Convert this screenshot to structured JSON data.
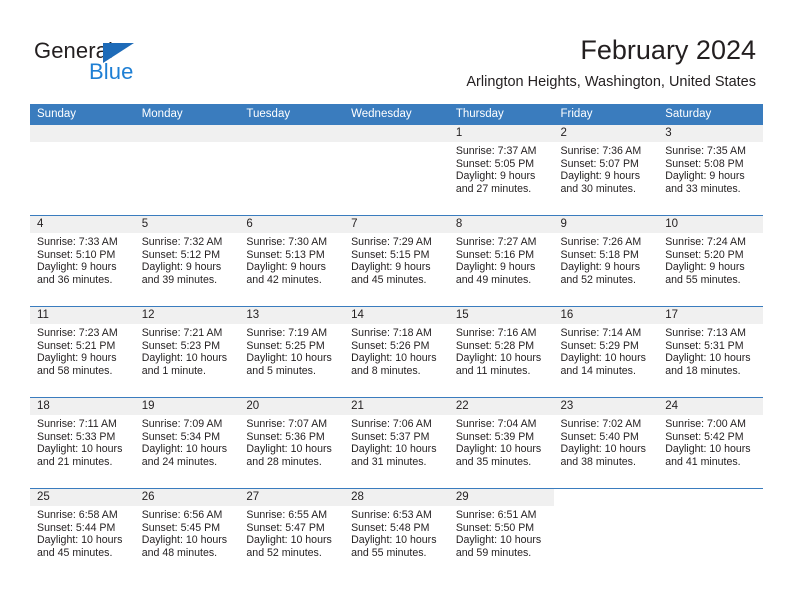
{
  "brand": {
    "name_part1": "General",
    "name_part2": "Blue",
    "logo_icon": "blue-triangle",
    "color_dark": "#231f20",
    "color_blue": "#1e7fd4"
  },
  "header": {
    "title": "February 2024",
    "subtitle": "Arlington Heights, Washington, United States",
    "accent_color": "#3a7cbe"
  },
  "calendar": {
    "weekday_headers": [
      "Sunday",
      "Monday",
      "Tuesday",
      "Wednesday",
      "Thursday",
      "Friday",
      "Saturday"
    ],
    "weeks": [
      [
        {
          "blank": true
        },
        {
          "blank": true
        },
        {
          "blank": true
        },
        {
          "blank": true
        },
        {
          "day": "1",
          "sunrise": "Sunrise: 7:37 AM",
          "sunset": "Sunset: 5:05 PM",
          "daylight_line1": "Daylight: 9 hours",
          "daylight_line2": "and 27 minutes."
        },
        {
          "day": "2",
          "sunrise": "Sunrise: 7:36 AM",
          "sunset": "Sunset: 5:07 PM",
          "daylight_line1": "Daylight: 9 hours",
          "daylight_line2": "and 30 minutes."
        },
        {
          "day": "3",
          "sunrise": "Sunrise: 7:35 AM",
          "sunset": "Sunset: 5:08 PM",
          "daylight_line1": "Daylight: 9 hours",
          "daylight_line2": "and 33 minutes."
        }
      ],
      [
        {
          "day": "4",
          "sunrise": "Sunrise: 7:33 AM",
          "sunset": "Sunset: 5:10 PM",
          "daylight_line1": "Daylight: 9 hours",
          "daylight_line2": "and 36 minutes."
        },
        {
          "day": "5",
          "sunrise": "Sunrise: 7:32 AM",
          "sunset": "Sunset: 5:12 PM",
          "daylight_line1": "Daylight: 9 hours",
          "daylight_line2": "and 39 minutes."
        },
        {
          "day": "6",
          "sunrise": "Sunrise: 7:30 AM",
          "sunset": "Sunset: 5:13 PM",
          "daylight_line1": "Daylight: 9 hours",
          "daylight_line2": "and 42 minutes."
        },
        {
          "day": "7",
          "sunrise": "Sunrise: 7:29 AM",
          "sunset": "Sunset: 5:15 PM",
          "daylight_line1": "Daylight: 9 hours",
          "daylight_line2": "and 45 minutes."
        },
        {
          "day": "8",
          "sunrise": "Sunrise: 7:27 AM",
          "sunset": "Sunset: 5:16 PM",
          "daylight_line1": "Daylight: 9 hours",
          "daylight_line2": "and 49 minutes."
        },
        {
          "day": "9",
          "sunrise": "Sunrise: 7:26 AM",
          "sunset": "Sunset: 5:18 PM",
          "daylight_line1": "Daylight: 9 hours",
          "daylight_line2": "and 52 minutes."
        },
        {
          "day": "10",
          "sunrise": "Sunrise: 7:24 AM",
          "sunset": "Sunset: 5:20 PM",
          "daylight_line1": "Daylight: 9 hours",
          "daylight_line2": "and 55 minutes."
        }
      ],
      [
        {
          "day": "11",
          "sunrise": "Sunrise: 7:23 AM",
          "sunset": "Sunset: 5:21 PM",
          "daylight_line1": "Daylight: 9 hours",
          "daylight_line2": "and 58 minutes."
        },
        {
          "day": "12",
          "sunrise": "Sunrise: 7:21 AM",
          "sunset": "Sunset: 5:23 PM",
          "daylight_line1": "Daylight: 10 hours",
          "daylight_line2": "and 1 minute."
        },
        {
          "day": "13",
          "sunrise": "Sunrise: 7:19 AM",
          "sunset": "Sunset: 5:25 PM",
          "daylight_line1": "Daylight: 10 hours",
          "daylight_line2": "and 5 minutes."
        },
        {
          "day": "14",
          "sunrise": "Sunrise: 7:18 AM",
          "sunset": "Sunset: 5:26 PM",
          "daylight_line1": "Daylight: 10 hours",
          "daylight_line2": "and 8 minutes."
        },
        {
          "day": "15",
          "sunrise": "Sunrise: 7:16 AM",
          "sunset": "Sunset: 5:28 PM",
          "daylight_line1": "Daylight: 10 hours",
          "daylight_line2": "and 11 minutes."
        },
        {
          "day": "16",
          "sunrise": "Sunrise: 7:14 AM",
          "sunset": "Sunset: 5:29 PM",
          "daylight_line1": "Daylight: 10 hours",
          "daylight_line2": "and 14 minutes."
        },
        {
          "day": "17",
          "sunrise": "Sunrise: 7:13 AM",
          "sunset": "Sunset: 5:31 PM",
          "daylight_line1": "Daylight: 10 hours",
          "daylight_line2": "and 18 minutes."
        }
      ],
      [
        {
          "day": "18",
          "sunrise": "Sunrise: 7:11 AM",
          "sunset": "Sunset: 5:33 PM",
          "daylight_line1": "Daylight: 10 hours",
          "daylight_line2": "and 21 minutes."
        },
        {
          "day": "19",
          "sunrise": "Sunrise: 7:09 AM",
          "sunset": "Sunset: 5:34 PM",
          "daylight_line1": "Daylight: 10 hours",
          "daylight_line2": "and 24 minutes."
        },
        {
          "day": "20",
          "sunrise": "Sunrise: 7:07 AM",
          "sunset": "Sunset: 5:36 PM",
          "daylight_line1": "Daylight: 10 hours",
          "daylight_line2": "and 28 minutes."
        },
        {
          "day": "21",
          "sunrise": "Sunrise: 7:06 AM",
          "sunset": "Sunset: 5:37 PM",
          "daylight_line1": "Daylight: 10 hours",
          "daylight_line2": "and 31 minutes."
        },
        {
          "day": "22",
          "sunrise": "Sunrise: 7:04 AM",
          "sunset": "Sunset: 5:39 PM",
          "daylight_line1": "Daylight: 10 hours",
          "daylight_line2": "and 35 minutes."
        },
        {
          "day": "23",
          "sunrise": "Sunrise: 7:02 AM",
          "sunset": "Sunset: 5:40 PM",
          "daylight_line1": "Daylight: 10 hours",
          "daylight_line2": "and 38 minutes."
        },
        {
          "day": "24",
          "sunrise": "Sunrise: 7:00 AM",
          "sunset": "Sunset: 5:42 PM",
          "daylight_line1": "Daylight: 10 hours",
          "daylight_line2": "and 41 minutes."
        }
      ],
      [
        {
          "day": "25",
          "sunrise": "Sunrise: 6:58 AM",
          "sunset": "Sunset: 5:44 PM",
          "daylight_line1": "Daylight: 10 hours",
          "daylight_line2": "and 45 minutes."
        },
        {
          "day": "26",
          "sunrise": "Sunrise: 6:56 AM",
          "sunset": "Sunset: 5:45 PM",
          "daylight_line1": "Daylight: 10 hours",
          "daylight_line2": "and 48 minutes."
        },
        {
          "day": "27",
          "sunrise": "Sunrise: 6:55 AM",
          "sunset": "Sunset: 5:47 PM",
          "daylight_line1": "Daylight: 10 hours",
          "daylight_line2": "and 52 minutes."
        },
        {
          "day": "28",
          "sunrise": "Sunrise: 6:53 AM",
          "sunset": "Sunset: 5:48 PM",
          "daylight_line1": "Daylight: 10 hours",
          "daylight_line2": "and 55 minutes."
        },
        {
          "day": "29",
          "sunrise": "Sunrise: 6:51 AM",
          "sunset": "Sunset: 5:50 PM",
          "daylight_line1": "Daylight: 10 hours",
          "daylight_line2": "and 59 minutes."
        },
        {
          "blank": true
        },
        {
          "blank": true
        }
      ]
    ]
  }
}
